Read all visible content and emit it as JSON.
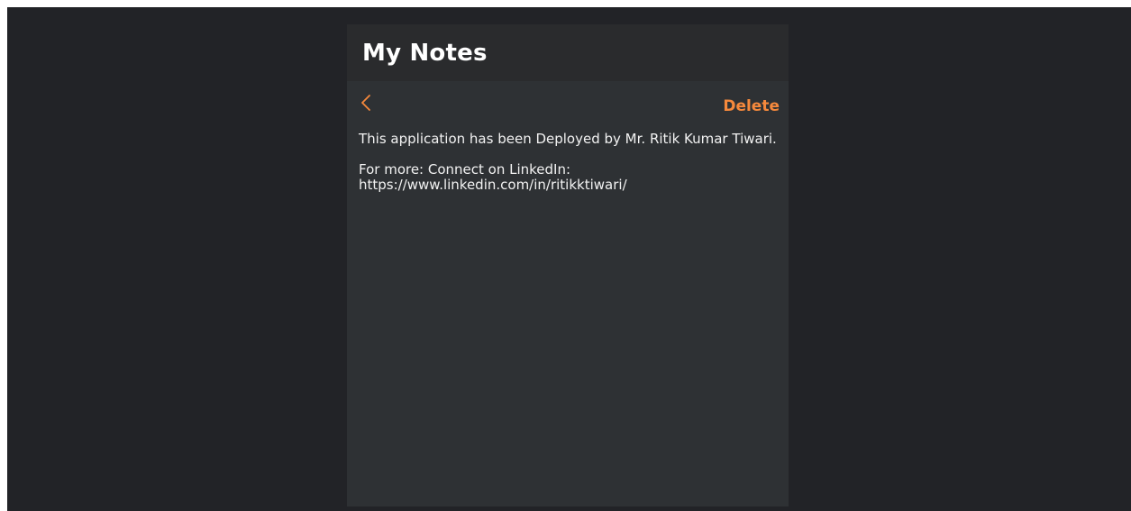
{
  "app": {
    "title": "My Notes"
  },
  "toolbar": {
    "back_icon": "chevron-left-icon",
    "delete_label": "Delete"
  },
  "note": {
    "paragraph_1": "This application has been Deployed by Mr. Ritik Kumar Tiwari.",
    "paragraph_2": "For more: Connect on LinkedIn: https://www.linkedin.com/in/ritikktiwari/"
  },
  "colors": {
    "page_background": "#222327",
    "app_background": "#2e3134",
    "header_background": "#2a2b2d",
    "accent": "#f6893c",
    "text": "#f2f2f2"
  }
}
